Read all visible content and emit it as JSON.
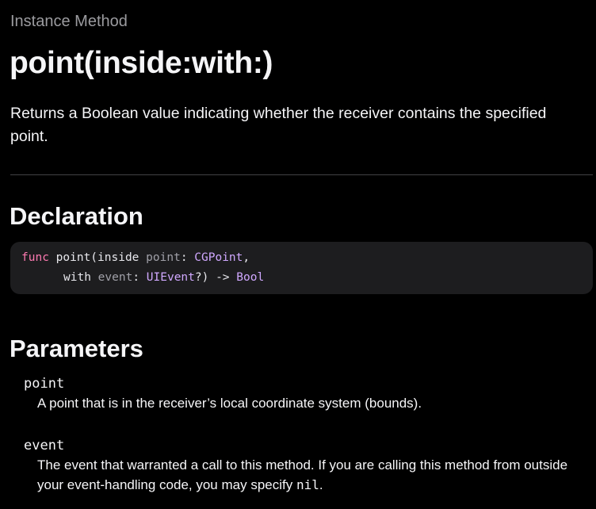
{
  "header": {
    "eyebrow": "Instance Method",
    "title": "point(inside:with:)"
  },
  "abstract": "Returns a Boolean value indicating whether the receiver contains the specified point.",
  "declaration": {
    "heading": "Declaration",
    "line1": {
      "keyword": "func",
      "name": "point(inside ",
      "param": "point",
      "colon": ": ",
      "type": "CGPoint",
      "trail": ","
    },
    "line2": {
      "label": "with ",
      "param": "event",
      "colon": ": ",
      "type": "UIEvent",
      "mid": "?) -> ",
      "return_type": "Bool"
    }
  },
  "parameters": {
    "heading": "Parameters",
    "items": [
      {
        "name": "point",
        "description": "A point that is in the receiver’s local coordinate system (bounds)."
      },
      {
        "name": "event",
        "description_before": "The event that warranted a call to this method. If you are calling this method from outside your event-handling code, you may specify ",
        "description_code": "nil",
        "description_after": "."
      }
    ]
  },
  "colors": {
    "background": "#000000",
    "code_background": "#1d1d1f",
    "keyword": "#ff7ab2",
    "type": "#d0a8ff",
    "param": "#a0a0a8",
    "divider": "#424245"
  }
}
